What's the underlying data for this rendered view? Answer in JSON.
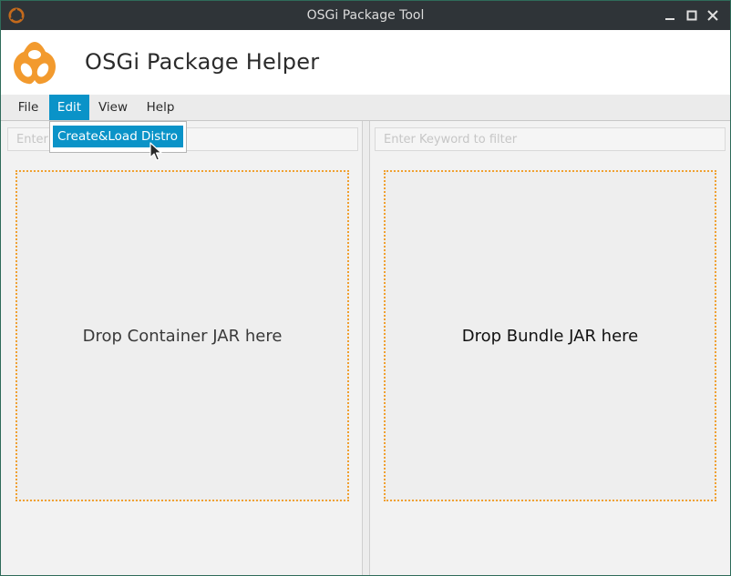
{
  "window": {
    "title": "OSGi Package Tool",
    "icon": "osgi-logo-icon",
    "controls": [
      "minimize-icon",
      "maximize-icon",
      "close-icon"
    ]
  },
  "header": {
    "title": "OSGi Package Helper",
    "logo": "osgi-logo-icon"
  },
  "menubar": {
    "file": "File",
    "edit": "Edit",
    "view": "View",
    "help": "Help"
  },
  "edit_menu": {
    "items": [
      "Create&Load Distro"
    ]
  },
  "left_panel": {
    "filter_placeholder": "Enter Keyword to filter",
    "drop_label": "Drop Container JAR here"
  },
  "right_panel": {
    "filter_placeholder": "Enter Keyword to filter",
    "drop_label": "Drop Bundle JAR here"
  },
  "colors": {
    "accent": "#0a93c8",
    "brand_orange": "#f29a2e",
    "dropzone_border": "#f0a030",
    "titlebar": "#2f3438"
  }
}
